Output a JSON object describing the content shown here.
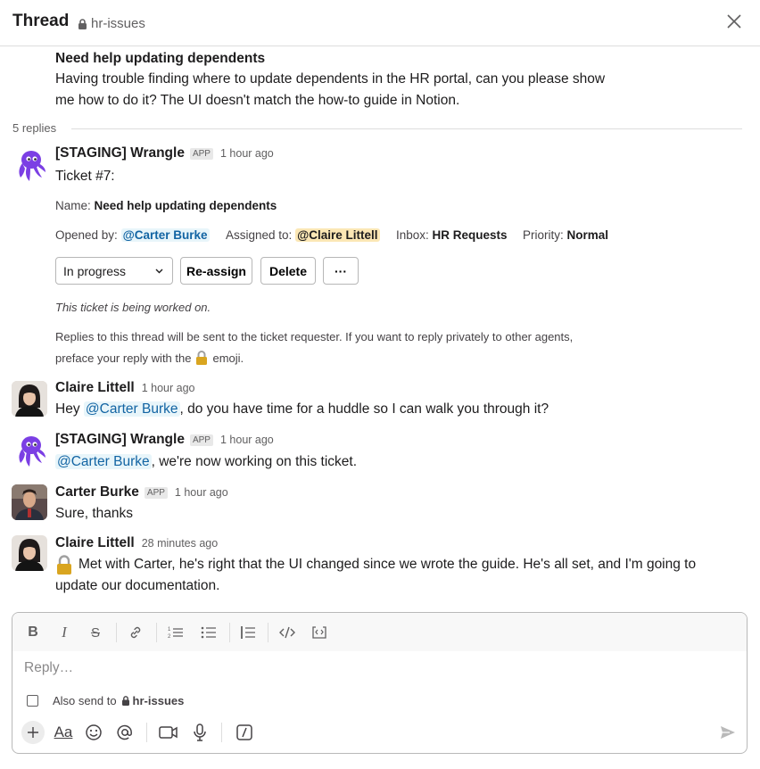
{
  "header": {
    "title": "Thread",
    "channel": "hr-issues"
  },
  "parent": {
    "title": "Need help updating dependents",
    "body_line1": "Having trouble finding where to update dependents in the HR portal, can you please show",
    "body_line2": "me how to do it? The UI doesn't match the how-to guide in Notion."
  },
  "replies_count": "5 replies",
  "messages": [
    {
      "name": "[STAGING] Wrangle",
      "badge": "APP",
      "time": "1 hour ago",
      "text": "Ticket #7:",
      "name_label": "Name:",
      "name_value": "Need help updating dependents",
      "opened_label": "Opened by:",
      "opened_value": "@Carter Burke",
      "assigned_label": "Assigned to:",
      "assigned_value": "@Claire Littell",
      "inbox_label": "Inbox:",
      "inbox_value": "HR Requests",
      "priority_label": "Priority:",
      "priority_value": "Normal",
      "status_select": "In progress",
      "reassign_label": "Re-assign",
      "delete_label": "Delete",
      "more_label": "···",
      "status_note": "This ticket is being worked on.",
      "info_line1": "Replies to this thread will be sent to the ticket requester. If you want to reply privately to other agents,",
      "info_line2_pre": "preface your reply with the",
      "info_line2_post": "emoji."
    },
    {
      "name": "Claire Littell",
      "time": "1 hour ago",
      "pre": "Hey",
      "mention": "@Carter Burke",
      "post": ", do you have time for a huddle so I can walk you through it?"
    },
    {
      "name": "[STAGING] Wrangle",
      "badge": "APP",
      "time": "1 hour ago",
      "mention": "@Carter Burke",
      "post": ", we're now working on this ticket."
    },
    {
      "name": "Carter Burke",
      "badge": "APP",
      "time": "1 hour ago",
      "text": "Sure, thanks"
    },
    {
      "name": "Claire Littell",
      "time": "28 minutes ago",
      "line1": "Met with Carter, he's right that the UI changed since we wrote the guide. He's all set, and I'm going to",
      "line2": "update our documentation."
    }
  ],
  "composer": {
    "placeholder": "Reply…",
    "also_send": "Also send to",
    "also_channel": "hr-issues"
  },
  "colors": {
    "accent": "#1264a3",
    "mention_bg": "#e8f5fa",
    "highlight": "#fbe7b5",
    "wrangle_purple": "#7b3fe4"
  }
}
